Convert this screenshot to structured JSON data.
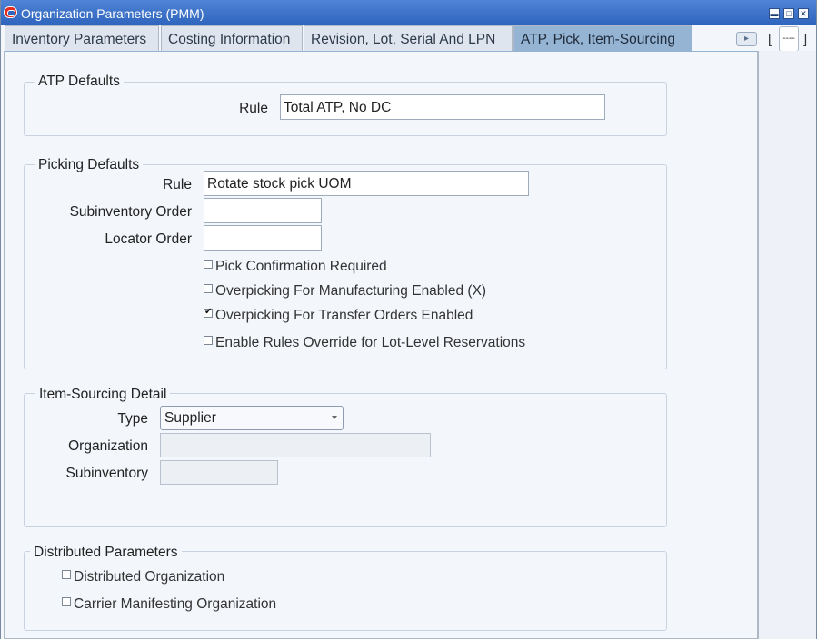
{
  "window": {
    "title": "Organization Parameters (PMM)"
  },
  "tabs": [
    {
      "label": "Inventory Parameters"
    },
    {
      "label": "Costing Information"
    },
    {
      "label": "Revision, Lot, Serial And LPN"
    },
    {
      "label": "ATP, Pick, Item-Sourcing"
    }
  ],
  "nav": {
    "open_bracket": "[",
    "close_bracket": "]",
    "value": "----"
  },
  "atp_defaults": {
    "title": "ATP Defaults",
    "rule_label": "Rule",
    "rule_value": "Total ATP, No DC"
  },
  "picking_defaults": {
    "title": "Picking Defaults",
    "rule_label": "Rule",
    "rule_value": "Rotate stock pick UOM",
    "subinventory_order_label": "Subinventory Order",
    "subinventory_order_value": "",
    "locator_order_label": "Locator Order",
    "locator_order_value": "",
    "checkboxes": [
      {
        "label": "Pick Confirmation Required",
        "checked": false
      },
      {
        "label": "Overpicking For Manufacturing Enabled (X)",
        "checked": false
      },
      {
        "label": "Overpicking For Transfer Orders Enabled",
        "checked": true
      },
      {
        "label": "Enable Rules Override for Lot-Level Reservations",
        "checked": false
      }
    ]
  },
  "item_sourcing": {
    "title": "Item-Sourcing Detail",
    "type_label": "Type",
    "type_value": "Supplier",
    "organization_label": "Organization",
    "organization_value": "",
    "subinventory_label": "Subinventory",
    "subinventory_value": ""
  },
  "distributed": {
    "title": "Distributed Parameters",
    "checkboxes": [
      {
        "label": "Distributed Organization",
        "checked": false
      },
      {
        "label": "Carrier Manifesting Organization",
        "checked": false
      }
    ]
  },
  "icons": {
    "app": "oracle-icon",
    "minimize": "minimize-icon",
    "maximize": "maximize-icon",
    "close": "close-icon",
    "tab_scroll": "chevron-right-icon",
    "dropdown": "chevron-down-icon"
  }
}
